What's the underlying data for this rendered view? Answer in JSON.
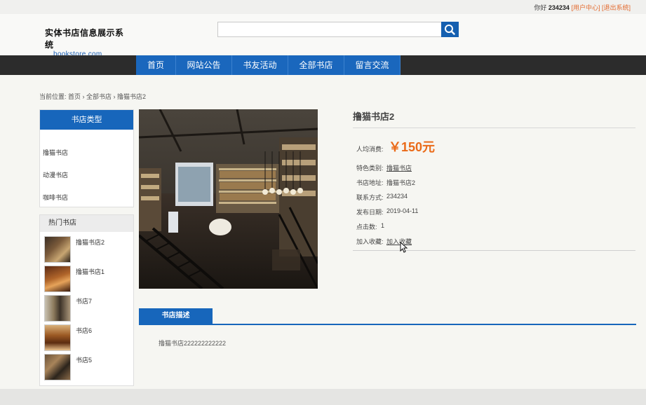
{
  "topbar": {
    "greeting": "你好",
    "username": "234234",
    "user_center": "[用户中心]",
    "logout": "[退出系统]"
  },
  "site": {
    "logo_cn": "实体书店信息展示系统",
    "logo_en": "bookstore.com"
  },
  "search": {
    "placeholder": "",
    "value": ""
  },
  "nav": {
    "items": [
      "首页",
      "网站公告",
      "书友活动",
      "全部书店",
      "留言交流"
    ]
  },
  "breadcrumb": "当前位置: 首页 › 全部书店 › 撸猫书店2",
  "sidebar": {
    "category_title": "书店类型",
    "categories": [
      "撸猫书店",
      "动漫书店",
      "咖啡书店"
    ],
    "hot_title": "热门书店",
    "hot": [
      "撸猫书店2",
      "撸猫书店1",
      "书店7",
      "书店6",
      "书店5"
    ]
  },
  "store": {
    "title": "撸猫书店2",
    "price_label": "人均消费:",
    "price": "￥150元",
    "category_label": "特色类别:",
    "category": "撸猫书店",
    "address_label": "书店地址:",
    "address": "撸猫书店2",
    "contact_label": "联系方式:",
    "contact": "234234",
    "date_label": "发布日期:",
    "date": "2019-04-11",
    "clicks_label": "点击数:",
    "clicks": "1",
    "fav_label": "加入收藏:",
    "fav_link": "加入收藏"
  },
  "description": {
    "tab": "书店描述",
    "text": "撸猫书店222222222222"
  },
  "colors": {
    "primary": "#1766bb",
    "accent": "#ea6a18",
    "navbar": "#2c2c2c"
  }
}
